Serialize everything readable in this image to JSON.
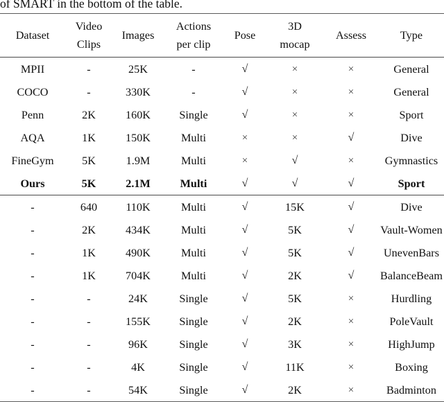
{
  "caption_tail": "of SMART in the bottom of the table.",
  "table": {
    "columns": [
      {
        "key": "dataset",
        "label_lines": [
          "Dataset",
          ""
        ]
      },
      {
        "key": "clips",
        "label_lines": [
          "Video",
          "Clips"
        ]
      },
      {
        "key": "images",
        "label_lines": [
          "Images",
          ""
        ]
      },
      {
        "key": "actions",
        "label_lines": [
          "Actions",
          "per clip"
        ]
      },
      {
        "key": "pose",
        "label_lines": [
          "Pose",
          ""
        ]
      },
      {
        "key": "mocap",
        "label_lines": [
          "3D",
          "mocap"
        ]
      },
      {
        "key": "assess",
        "label_lines": [
          "Assess",
          ""
        ]
      },
      {
        "key": "type",
        "label_lines": [
          "Type",
          ""
        ]
      }
    ],
    "sections": [
      {
        "name": "comparison-datasets",
        "rows": [
          {
            "bold": false,
            "cells": [
              "MPII",
              "-",
              "25K",
              "-",
              "check",
              "cross",
              "cross",
              "General"
            ]
          },
          {
            "bold": false,
            "cells": [
              "COCO",
              "-",
              "330K",
              "-",
              "check",
              "cross",
              "cross",
              "General"
            ]
          },
          {
            "bold": false,
            "cells": [
              "Penn",
              "2K",
              "160K",
              "Single",
              "check",
              "cross",
              "cross",
              "Sport"
            ]
          },
          {
            "bold": false,
            "cells": [
              "AQA",
              "1K",
              "150K",
              "Multi",
              "cross",
              "cross",
              "check",
              "Dive"
            ]
          },
          {
            "bold": false,
            "cells": [
              "FineGym",
              "5K",
              "1.9M",
              "Multi",
              "cross",
              "check",
              "cross",
              "Gymnastics"
            ]
          },
          {
            "bold": true,
            "cells": [
              "Ours",
              "5K",
              "2.1M",
              "Multi",
              "check",
              "check",
              "check",
              "Sport"
            ]
          }
        ]
      },
      {
        "name": "ours-subsets",
        "rows": [
          {
            "bold": false,
            "cells": [
              "-",
              "640",
              "110K",
              "Multi",
              "check",
              "15K",
              "check",
              "Dive"
            ]
          },
          {
            "bold": false,
            "cells": [
              "-",
              "2K",
              "434K",
              "Multi",
              "check",
              "5K",
              "check",
              "Vault-Women"
            ]
          },
          {
            "bold": false,
            "cells": [
              "-",
              "1K",
              "490K",
              "Multi",
              "check",
              "5K",
              "check",
              "UnevenBars"
            ]
          },
          {
            "bold": false,
            "cells": [
              "-",
              "1K",
              "704K",
              "Multi",
              "check",
              "2K",
              "check",
              "BalanceBeam"
            ]
          },
          {
            "bold": false,
            "cells": [
              "-",
              "-",
              "24K",
              "Single",
              "check",
              "5K",
              "cross",
              "Hurdling"
            ]
          },
          {
            "bold": false,
            "cells": [
              "-",
              "-",
              "155K",
              "Single",
              "check",
              "2K",
              "cross",
              "PoleVault"
            ]
          },
          {
            "bold": false,
            "cells": [
              "-",
              "-",
              "96K",
              "Single",
              "check",
              "3K",
              "cross",
              "HighJump"
            ]
          },
          {
            "bold": false,
            "cells": [
              "-",
              "-",
              "4K",
              "Single",
              "check",
              "11K",
              "cross",
              "Boxing"
            ]
          },
          {
            "bold": false,
            "cells": [
              "-",
              "-",
              "54K",
              "Single",
              "check",
              "2K",
              "cross",
              "Badminton"
            ]
          }
        ]
      }
    ],
    "glyphs": {
      "check": "√",
      "cross": "×"
    }
  }
}
